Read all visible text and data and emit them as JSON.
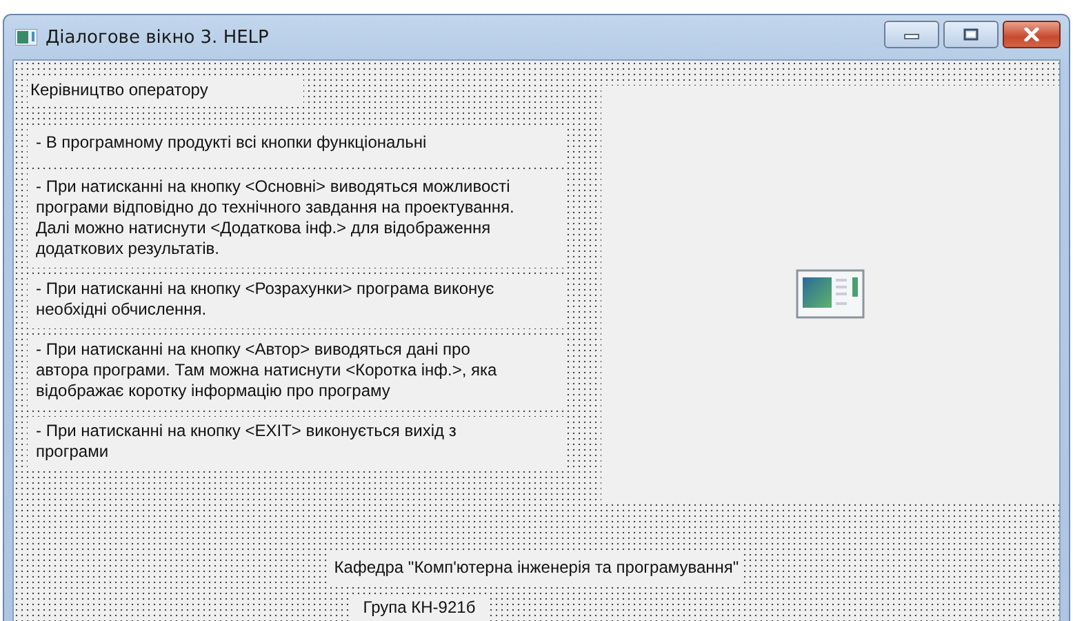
{
  "window": {
    "title": "Діалогове вікно 3. HELP"
  },
  "form": {
    "heading": "Керівництво оператору",
    "paragraphs": [
      "- В програмному продукті всі кнопки функціональні",
      "- При натисканні на кнопку <Основні> виводяться можливості програми відповідно до технічного завдання на проектування. Далі можно натиснути <Додаткова інф.> для відображення додаткових результатів.",
      "- При натисканні на кнопку <Розрахунки> програма виконує необхідні обчислення.",
      "- При натисканні на кнопку <Автор> виводяться дані про автора програми. Там можна натиснути <Коротка інф.>, яка відображає коротку інформацію про програму",
      "- При натисканні на кнопку <EXIT> виконується вихід з програми"
    ],
    "image": {
      "kind": "empty"
    },
    "department": "Кафедра \"Комп'ютерна інженерія та програмування\"",
    "group": "Група КН-921б"
  }
}
